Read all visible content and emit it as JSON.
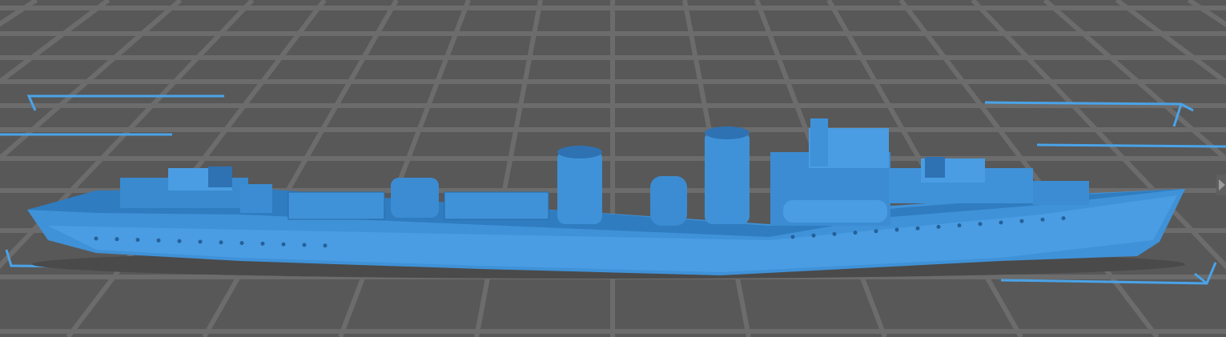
{
  "viewport": {
    "background_color": "#585858",
    "grid_color": "#6c6c6c",
    "model_color": "#3f92d8",
    "model_shadow_color": "#2c6da8",
    "bounding_marker_color": "#4aa3e8"
  },
  "controls": {
    "expand_panel_icon": "triangle-right-icon"
  }
}
